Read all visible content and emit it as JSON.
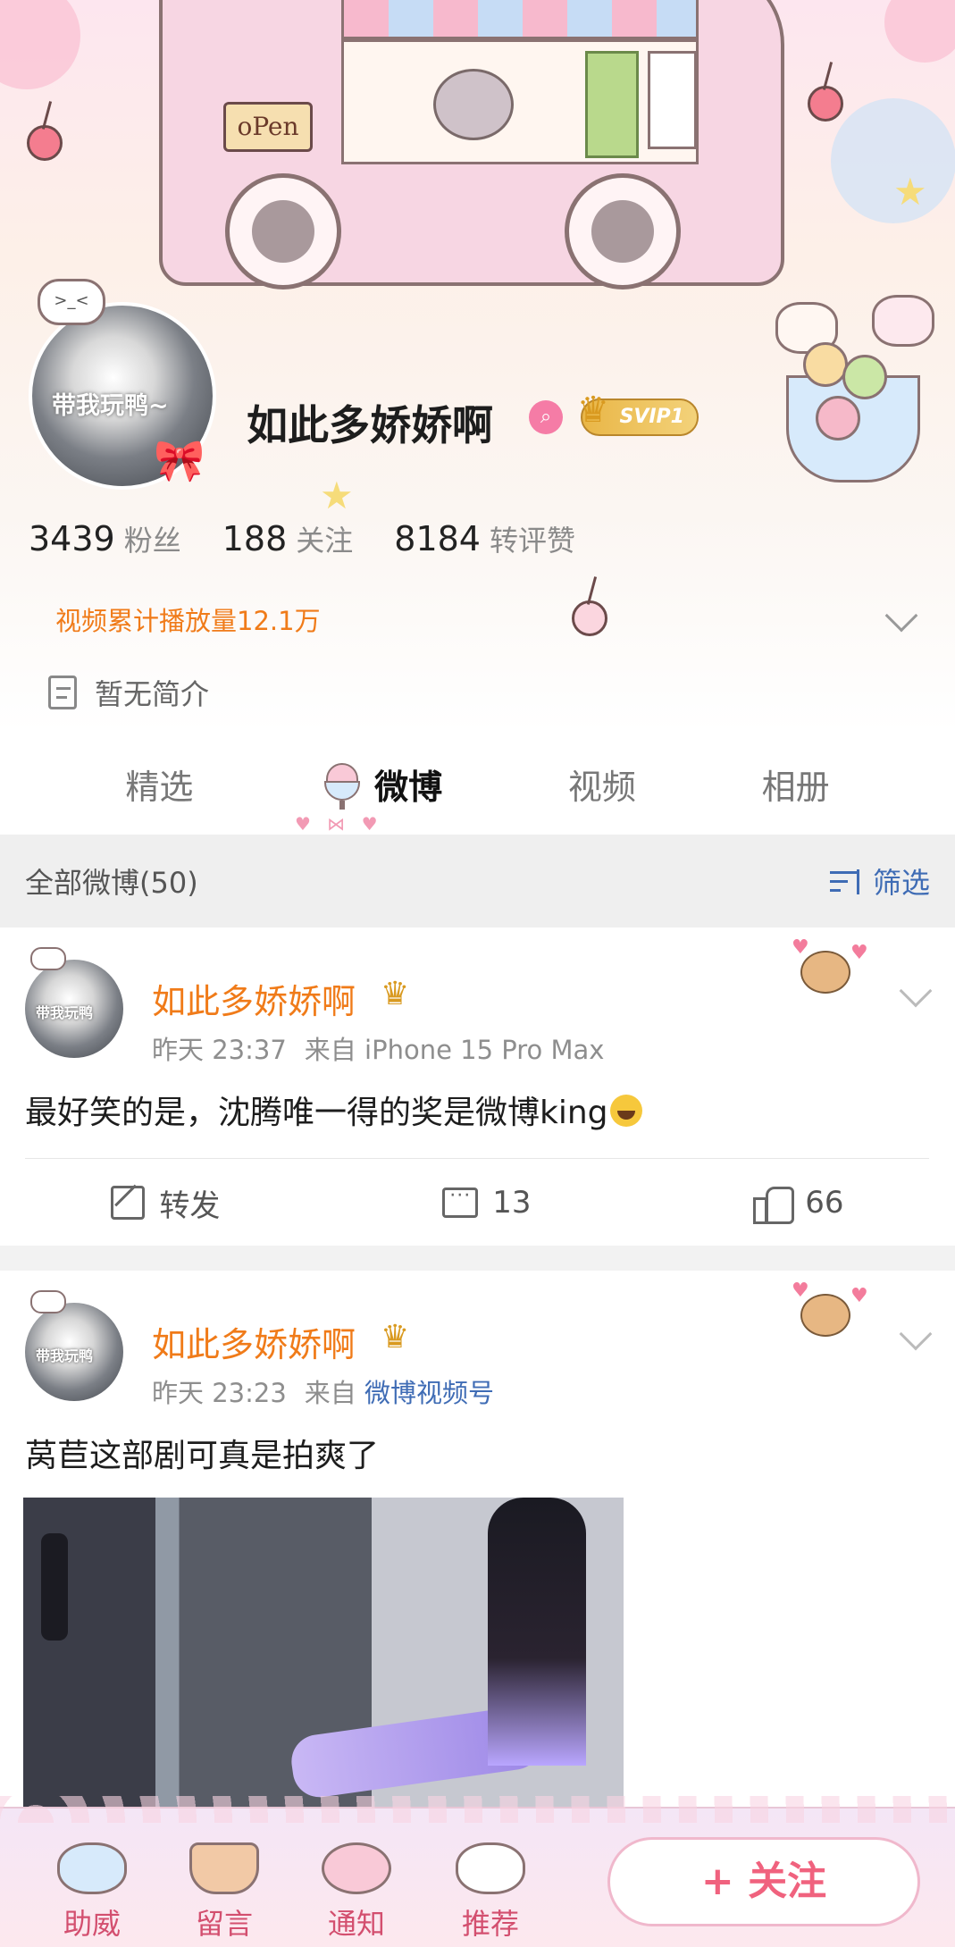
{
  "profile": {
    "name": "如此多娇娇啊",
    "avatar_tag": "带我玩鸭~",
    "avatar_bubble": ">_<",
    "vip_label": "SVIP1",
    "open_sign": "oPen",
    "stats": [
      {
        "value": "3439",
        "label": "粉丝"
      },
      {
        "value": "188",
        "label": "关注"
      },
      {
        "value": "8184",
        "label": "转评赞"
      }
    ],
    "play_count": "视频累计播放量12.1万",
    "bio": "暂无简介"
  },
  "tabs": [
    {
      "label": "精选",
      "active": false
    },
    {
      "label": "微博",
      "active": true
    },
    {
      "label": "视频",
      "active": false
    },
    {
      "label": "相册",
      "active": false
    }
  ],
  "filter": {
    "title": "全部微博(50)",
    "button_label": "筛选"
  },
  "posts": [
    {
      "author": "如此多娇娇啊",
      "avatar_tag": "带我玩鸭",
      "time": "昨天 23:37",
      "source_prefix": "来自",
      "source": "iPhone 15 Pro Max",
      "text": "最好笑的是，沈腾唯一得的奖是微博king",
      "reposts_label": "转发",
      "comments": "13",
      "likes": "66"
    },
    {
      "author": "如此多娇娇啊",
      "avatar_tag": "带我玩鸭",
      "time": "昨天 23:23",
      "source_prefix": "来自",
      "source": "微博视频号",
      "text": "莴苣这部剧可真是拍爽了"
    }
  ],
  "bottom_nav": [
    {
      "label": "助威",
      "icon": "bunny-icon"
    },
    {
      "label": "留言",
      "icon": "cake-icon"
    },
    {
      "label": "通知",
      "icon": "donut-icon"
    },
    {
      "label": "推荐",
      "icon": "puppy-icon"
    }
  ],
  "follow_button": "+ 关注",
  "colors": {
    "accent_orange": "#f07b19",
    "link_blue": "#3f6cb5",
    "pink": "#f0627e"
  }
}
